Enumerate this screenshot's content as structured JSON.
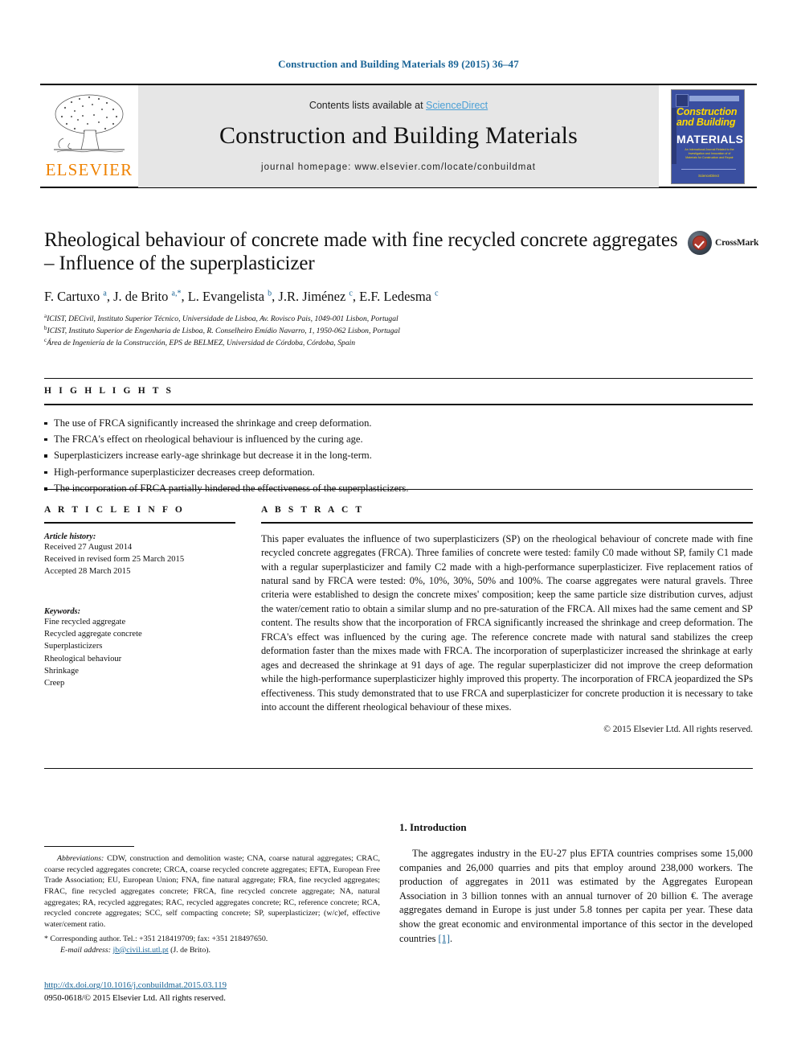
{
  "running_head": "Construction and Building Materials 89 (2015) 36–47",
  "masthead": {
    "publisher_logo_label": "ELSEVIER",
    "contents_prefix": "Contents lists available at ",
    "sciencedirect": "ScienceDirect",
    "journal_title": "Construction and Building Materials",
    "homepage_line": "journal homepage: www.elsevier.com/locate/conbuildmat",
    "cover": {
      "line1": "Construction",
      "line2": "and Building",
      "line3": "MATERIALS",
      "subtitle": "An International Journal Related to the Investigation and Innovation of of Materials for Construction and Repair",
      "footer": "ScienceDirect"
    }
  },
  "article": {
    "title": "Rheological behaviour of concrete made with fine recycled concrete aggregates – Influence of the superplasticizer",
    "authors_html": "F. Cartuxo <sup>a</sup>, J. de Brito <sup>a,*</sup>, L. Evangelista <sup>b</sup>, J.R. Jiménez <sup>c</sup>, E.F. Ledesma <sup>c</sup>",
    "affiliations": [
      "ICIST, DECivil, Instituto Superior Técnico, Universidade de Lisboa, Av. Rovisco Pais, 1049-001 Lisbon, Portugal",
      "ICIST, Instituto Superior de Engenharia de Lisboa, R. Conselheiro Emídio Navarro, 1, 1950-062 Lisbon, Portugal",
      "Área de Ingeniería de la Construcción, EPS de BELMEZ, Universidad de Córdoba, Córdoba, Spain"
    ],
    "affiliation_marks": [
      "a",
      "b",
      "c"
    ],
    "crossmark_label": "CrossMark"
  },
  "highlights": {
    "heading": "H I G H L I G H T S",
    "items": [
      "The use of FRCA significantly increased the shrinkage and creep deformation.",
      "The FRCA's effect on rheological behaviour is influenced by the curing age.",
      "Superplasticizers increase early-age shrinkage but decrease it in the long-term.",
      "High-performance superplasticizer decreases creep deformation.",
      "The incorporation of FRCA partially hindered the effectiveness of the superplasticizers."
    ]
  },
  "article_info": {
    "heading": "A R T I C L E    I N F O",
    "history_label": "Article history:",
    "history": [
      "Received 27 August 2014",
      "Received in revised form 25 March 2015",
      "Accepted 28 March 2015"
    ],
    "keywords_label": "Keywords:",
    "keywords": [
      "Fine recycled aggregate",
      "Recycled aggregate concrete",
      "Superplasticizers",
      "Rheological behaviour",
      "Shrinkage",
      "Creep"
    ]
  },
  "abstract": {
    "heading": "A B S T R A C T",
    "text": "This paper evaluates the influence of two superplasticizers (SP) on the rheological behaviour of concrete made with fine recycled concrete aggregates (FRCA). Three families of concrete were tested: family C0 made without SP, family C1 made with a regular superplasticizer and family C2 made with a high-performance superplasticizer. Five replacement ratios of natural sand by FRCA were tested: 0%, 10%, 30%, 50% and 100%. The coarse aggregates were natural gravels. Three criteria were established to design the concrete mixes' composition; keep the same particle size distribution curves, adjust the water/cement ratio to obtain a similar slump and no pre-saturation of the FRCA. All mixes had the same cement and SP content. The results show that the incorporation of FRCA significantly increased the shrinkage and creep deformation. The FRCA's effect was influenced by the curing age. The reference concrete made with natural sand stabilizes the creep deformation faster than the mixes made with FRCA. The incorporation of superplasticizer increased the shrinkage at early ages and decreased the shrinkage at 91 days of age. The regular superplasticizer did not improve the creep deformation while the high-performance superplasticizer highly improved this property. The incorporation of FRCA jeopardized the SPs effectiveness. This study demonstrated that to use FRCA and superplasticizer for concrete production it is necessary to take into account the different rheological behaviour of these mixes.",
    "copyright": "© 2015 Elsevier Ltd. All rights reserved."
  },
  "footnotes": {
    "abbreviations_label": "Abbreviations:",
    "abbreviations_text": " CDW, construction and demolition waste; CNA, coarse natural aggregates; CRAC, coarse recycled aggregates concrete; CRCA, coarse recycled concrete aggregates; EFTA, European Free Trade Association; EU, European Union; FNA, fine natural aggregate; FRA, fine recycled aggregates; FRAC, fine recycled aggregates concrete; FRCA, fine recycled concrete aggregate; NA, natural aggregates; RA, recycled aggregates; RAC, recycled aggregates concrete; RC, reference concrete; RCA, recycled concrete aggregates; SCC, self compacting concrete; SP, superplasticizer; (w/c)ef, effective water/cement ratio.",
    "corresponding": "* Corresponding author. Tel.: +351 218419709; fax: +351 218497650.",
    "email_label": "E-mail address:",
    "email": "jb@civil.ist.utl.pt",
    "email_suffix": " (J. de Brito)."
  },
  "footer": {
    "doi": "http://dx.doi.org/10.1016/j.conbuildmat.2015.03.119",
    "issn_copyright": "0950-0618/© 2015 Elsevier Ltd. All rights reserved."
  },
  "introduction": {
    "heading": "1. Introduction",
    "paragraph": "The aggregates industry in the EU-27 plus EFTA countries comprises some 15,000 companies and 26,000 quarries and pits that employ around 238,000 workers. The production of aggregates in 2011 was estimated by the Aggregates European Association in 3 billion tonnes with an annual turnover of 20 billion €. The average aggregates demand in Europe is just under 5.8 tonnes per capita per year. These data show the great economic and environmental importance of this sector in the developed countries ",
    "reference": "[1]",
    "paragraph_end": "."
  },
  "colors": {
    "link_blue": "#1a6496",
    "elsevier_orange": "#ef8200",
    "sciencedirect_blue": "#4a9fd5",
    "cover_blue": "#3a4fa0"
  }
}
